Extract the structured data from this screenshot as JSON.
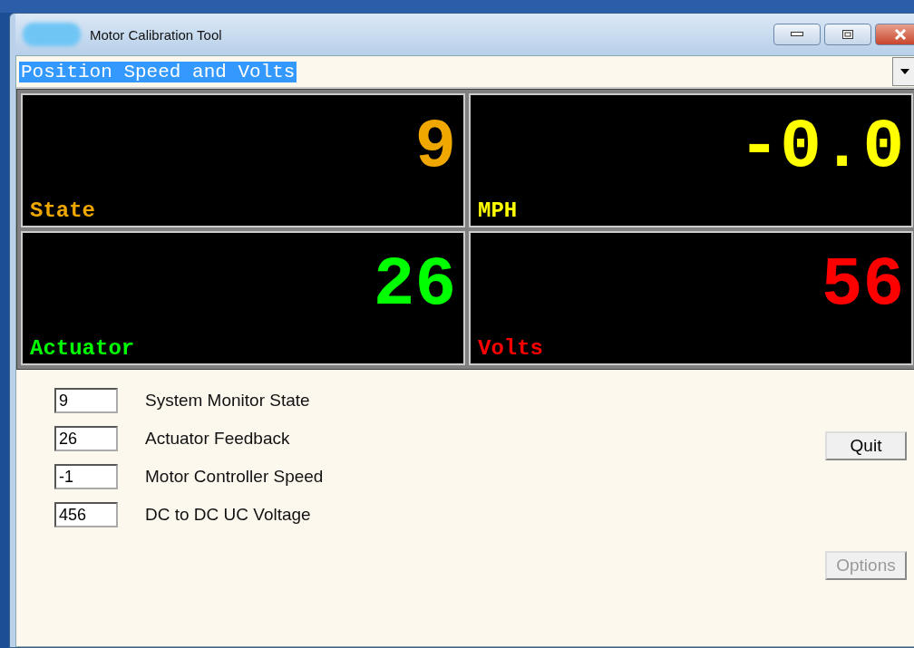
{
  "window": {
    "title": "Motor Calibration Tool"
  },
  "view_select": {
    "value": "Position Speed and Volts"
  },
  "displays": [
    {
      "label": "State",
      "value": "9",
      "color": "#f0a800"
    },
    {
      "label": "MPH",
      "value": "-0.0",
      "color": "#ffff00"
    },
    {
      "label": "Actuator",
      "value": "26",
      "color": "#00ff00"
    },
    {
      "label": "Volts",
      "value": "56",
      "color": "#ff0000"
    }
  ],
  "readouts": [
    {
      "value": "9",
      "label": "System Monitor State"
    },
    {
      "value": "26",
      "label": "Actuator Feedback"
    },
    {
      "value": "-1",
      "label": "Motor Controller Speed"
    },
    {
      "value": "456",
      "label": "DC to DC UC Voltage"
    }
  ],
  "buttons": [
    {
      "label": "Quit",
      "disabled": false
    },
    {
      "label": "Options",
      "disabled": true
    }
  ]
}
